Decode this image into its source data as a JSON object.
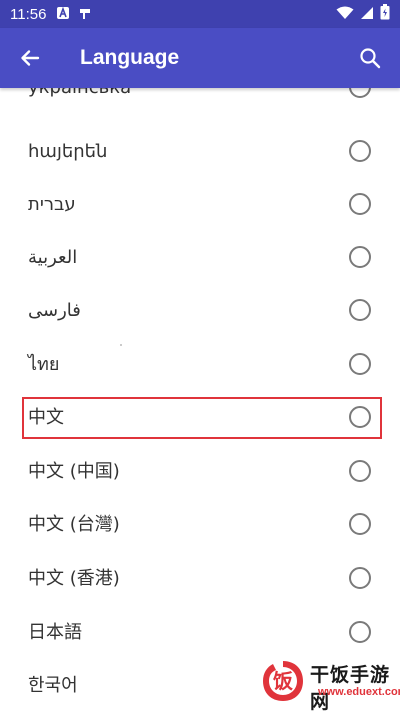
{
  "status_bar": {
    "time": "11:56",
    "left_icons": [
      "a-badge-icon",
      "signal-flag-icon"
    ],
    "right_icons": [
      "wifi-icon",
      "cellular-icon",
      "battery-icon"
    ]
  },
  "app_bar": {
    "title": "Language",
    "back_icon": "arrow-left-icon",
    "search_icon": "search-icon",
    "color": "#4A4DC4"
  },
  "languages": [
    {
      "label": "українська",
      "selected": false
    },
    {
      "label": "հայերեն",
      "selected": false
    },
    {
      "label": "עברית",
      "selected": false
    },
    {
      "label": "العربية",
      "selected": false
    },
    {
      "label": "فارسی",
      "selected": false
    },
    {
      "label": "ไทย",
      "selected": false
    },
    {
      "label": "中文",
      "selected": false,
      "highlighted": true
    },
    {
      "label": "中文 (中国)",
      "selected": false
    },
    {
      "label": "中文 (台灣)",
      "selected": false
    },
    {
      "label": "中文 (香港)",
      "selected": false
    },
    {
      "label": "日本語",
      "selected": false
    },
    {
      "label": "한국어",
      "selected": false
    }
  ],
  "highlight_color": "#E0343B",
  "watermark": {
    "logo_glyph": "饭",
    "text": "干饭手游网",
    "url": "www.eduext.com"
  }
}
